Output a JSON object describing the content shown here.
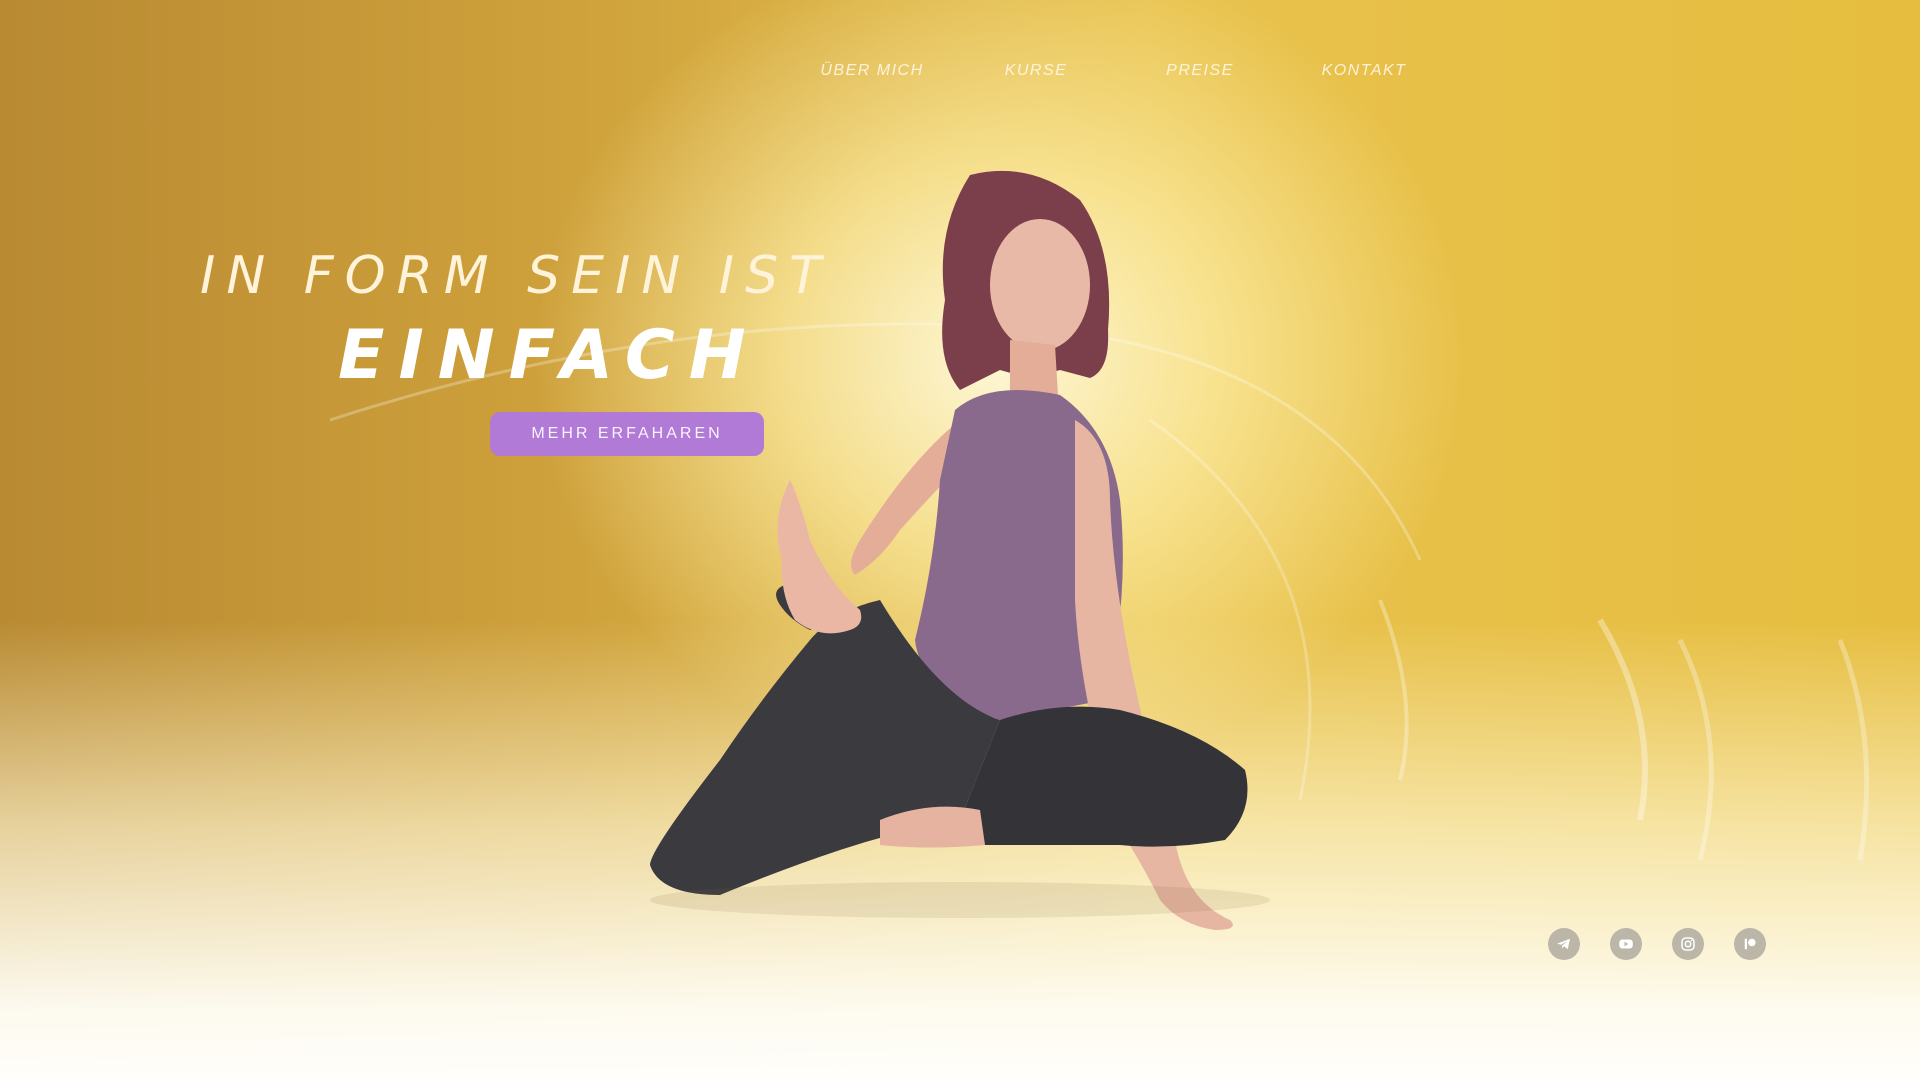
{
  "nav": {
    "items": [
      {
        "label": "ÜBER MICH"
      },
      {
        "label": "KURSE"
      },
      {
        "label": "PREISE"
      },
      {
        "label": "KONTAKT"
      }
    ]
  },
  "hero": {
    "line1": "IN FORM SEIN IST",
    "line2": "EINFACH",
    "cta_label": "MEHR ERFAHAREN"
  },
  "social": {
    "icons": [
      "telegram-icon",
      "youtube-icon",
      "instagram-icon",
      "patreon-icon"
    ]
  },
  "colors": {
    "accent": "#b07ad6",
    "background_gold": "#d9ae3f",
    "social_icon_bg": "#bcb6a8"
  }
}
